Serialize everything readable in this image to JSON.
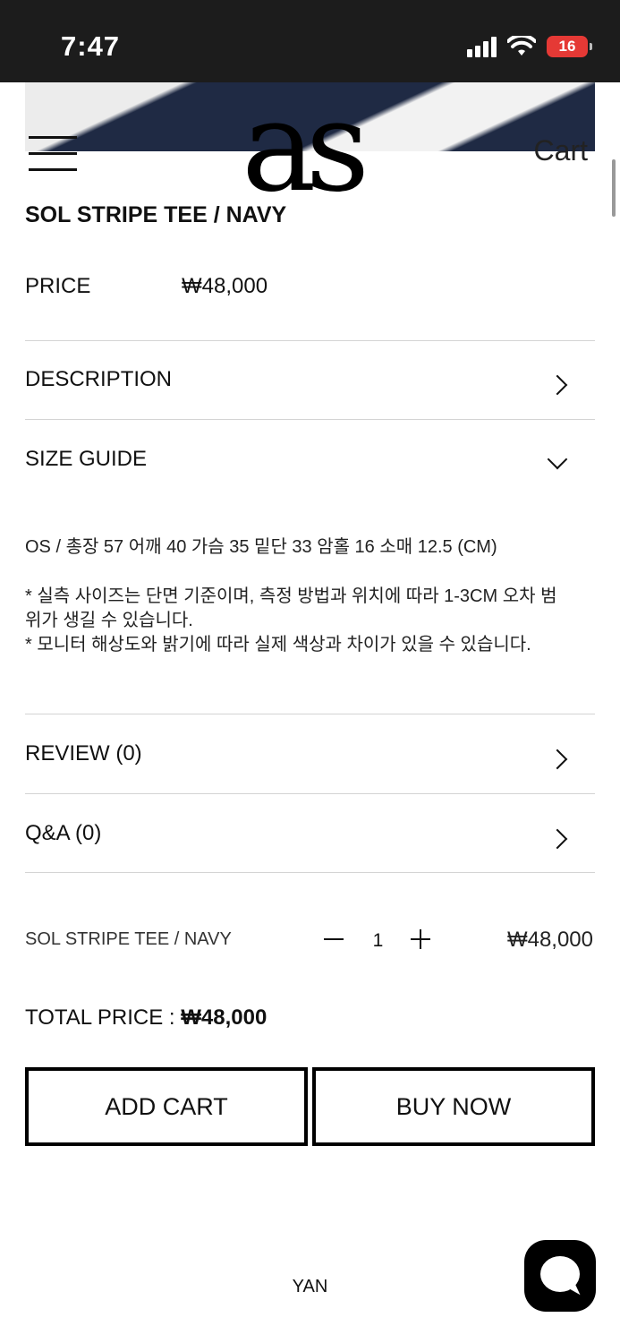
{
  "status": {
    "time": "7:47",
    "battery": "16"
  },
  "header": {
    "logo": "as",
    "cart": "Cart"
  },
  "product": {
    "title": "SOL STRIPE TEE / NAVY",
    "price_label": "PRICE",
    "price": "₩48,000"
  },
  "accordion": {
    "description": "DESCRIPTION",
    "size_guide": "SIZE GUIDE",
    "review": "REVIEW (0)",
    "qa": "Q&A (0)"
  },
  "size_guide": {
    "measurements": "OS / 총장 57 어깨 40 가슴 35 밑단 33 암홀 16 소매 12.5 (CM)",
    "note1": "* 실측 사이즈는 단면 기준이며, 측정 방법과 위치에 따라 1-3CM 오차 범위가 생길 수 있습니다.",
    "note2": "* 모니터 해상도와 밝기에 따라 실제 색상과 차이가 있을 수 있습니다."
  },
  "order_item": {
    "name": "SOL STRIPE TEE / NAVY",
    "quantity": "1",
    "price": "₩48,000"
  },
  "total": {
    "label": "TOTAL PRICE :",
    "value": "₩48,000"
  },
  "buttons": {
    "add_cart": "ADD CART",
    "buy_now": "BUY NOW"
  },
  "footer": {
    "text": "YAN"
  },
  "icons": [
    "signal-icon",
    "wifi-icon",
    "battery-icon",
    "menu-icon",
    "chevron-right-icon",
    "chevron-down-icon",
    "minus-icon",
    "plus-icon",
    "chat-icon"
  ],
  "colors": {
    "battery": "#e53935",
    "status_bar": "#1c1c1c",
    "accent": "#000000"
  }
}
